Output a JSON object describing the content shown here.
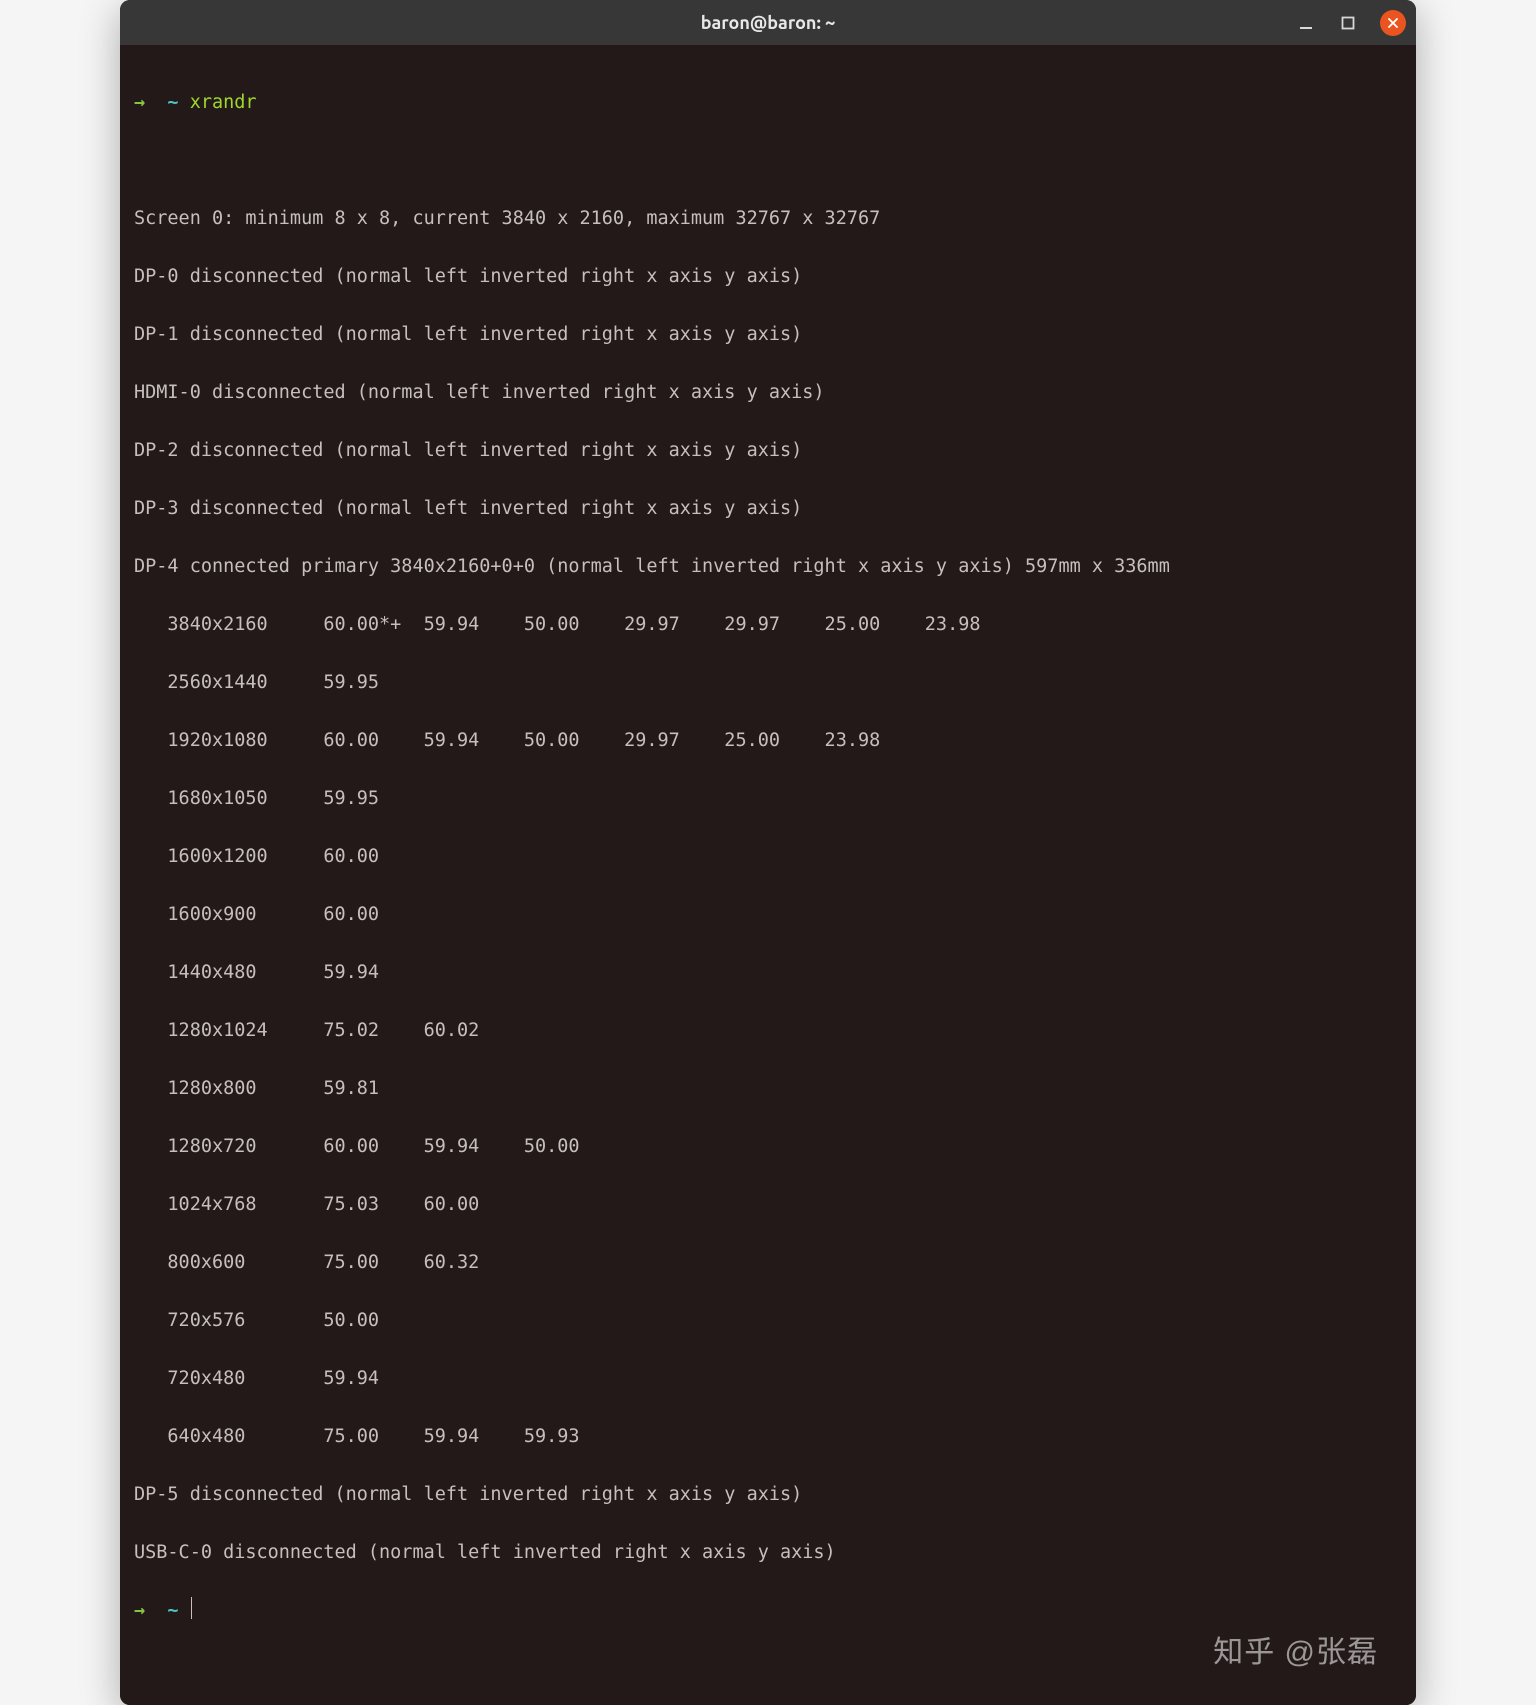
{
  "window": {
    "title": "baron@baron: ~"
  },
  "prompt": {
    "arrow": "→",
    "tilde": "~",
    "command": "xrandr"
  },
  "output": {
    "screen": "Screen 0: minimum 8 x 8, current 3840 x 2160, maximum 32767 x 32767",
    "dp0": "DP-0 disconnected (normal left inverted right x axis y axis)",
    "dp1": "DP-1 disconnected (normal left inverted right x axis y axis)",
    "hdmi0": "HDMI-0 disconnected (normal left inverted right x axis y axis)",
    "dp2": "DP-2 disconnected (normal left inverted right x axis y axis)",
    "dp3": "DP-3 disconnected (normal left inverted right x axis y axis)",
    "dp4": "DP-4 connected primary 3840x2160+0+0 (normal left inverted right x axis y axis) 597mm x 336mm",
    "m0": "   3840x2160     60.00*+  59.94    50.00    29.97    29.97    25.00    23.98",
    "m1": "   2560x1440     59.95",
    "m2": "   1920x1080     60.00    59.94    50.00    29.97    25.00    23.98",
    "m3": "   1680x1050     59.95",
    "m4": "   1600x1200     60.00",
    "m5": "   1600x900      60.00",
    "m6": "   1440x480      59.94",
    "m7": "   1280x1024     75.02    60.02",
    "m8": "   1280x800      59.81",
    "m9": "   1280x720      60.00    59.94    50.00",
    "m10": "   1024x768      75.03    60.00",
    "m11": "   800x600       75.00    60.32",
    "m12": "   720x576       50.00",
    "m13": "   720x480       59.94",
    "m14": "   640x480       75.00    59.94    59.93",
    "dp5": "DP-5 disconnected (normal left inverted right x axis y axis)",
    "usbc0": "USB-C-0 disconnected (normal left inverted right x axis y axis)"
  },
  "watermark": "知乎 @张磊"
}
